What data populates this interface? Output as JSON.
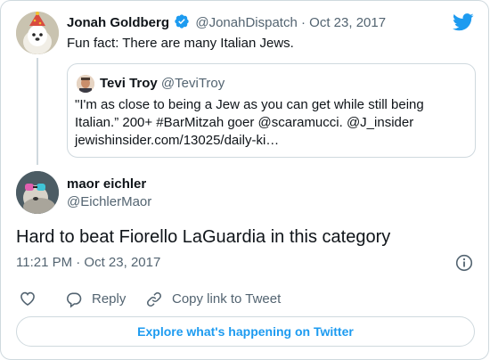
{
  "tweet1": {
    "name": "Jonah Goldberg",
    "handle": "@JonahDispatch",
    "separator": "·",
    "date": "Oct 23, 2017",
    "text": "Fun fact: There are many Italian Jews."
  },
  "quote": {
    "name": "Tevi Troy",
    "handle": "@TeviTroy",
    "line1": "\"I'm as close to being a Jew as you can get while still being",
    "line2": "Italian.” 200+ #BarMitzah goer @scaramucci. @J_insider",
    "line3": "jewishinsider.com/13025/daily-ki…"
  },
  "tweet2": {
    "name": "maor eichler",
    "handle": "@EichlerMaor",
    "text": "Hard to beat Fiorello LaGuardia in this category",
    "time": "11:21 PM · Oct 23, 2017"
  },
  "actions": {
    "reply_label": "Reply",
    "copy_link_label": "Copy link to Tweet"
  },
  "cta_label": "Explore what's happening on Twitter",
  "icons": {
    "verified": "verified-badge-icon",
    "brand": "twitter-bird-icon",
    "info": "info-icon",
    "like": "heart-icon",
    "reply": "speech-bubble-icon",
    "copy_link": "link-icon"
  },
  "colors": {
    "accent": "#1d9bf0",
    "text": "#0f1419",
    "secondary_text": "#536471",
    "border": "#cfd9de"
  }
}
